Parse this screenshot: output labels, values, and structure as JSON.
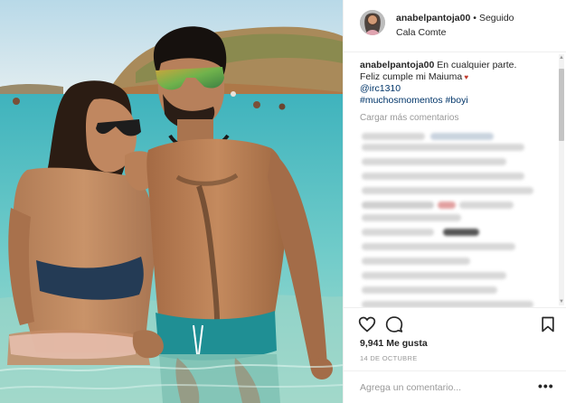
{
  "photo": {
    "description_icon": "beach-photo"
  },
  "header": {
    "username": "anabelpantoja00",
    "separator": "•",
    "follow_status": "Seguido",
    "location": "Cala Comte"
  },
  "caption": {
    "username": "anabelpantoja00",
    "line1": "En cualquier parte.",
    "line2": "Feliz cumple mi Maiuma",
    "mention": "@irc1310",
    "hashtag1": "#muchosmomentos",
    "hashtag2": "#boyi"
  },
  "comments": {
    "load_more": "Cargar más comentarios"
  },
  "actions": {
    "like_icon": "heart-icon",
    "comment_icon": "comment-icon",
    "save_icon": "bookmark-icon"
  },
  "likes": "9,941 Me gusta",
  "date": "14 DE OCTUBRE",
  "comment_input": {
    "placeholder": "Agrega un comentario..."
  },
  "options_label": "•••",
  "colors": {
    "link": "#003569",
    "muted": "#999999",
    "border": "#efefef",
    "water": "#4fc3c7",
    "sky": "#cfe6ef"
  }
}
